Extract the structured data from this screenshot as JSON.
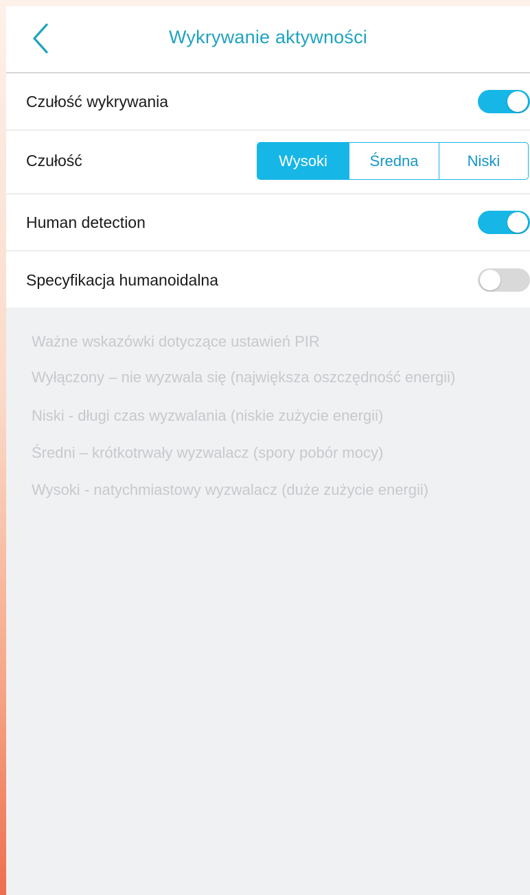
{
  "header": {
    "title": "Wykrywanie aktywności"
  },
  "settings": {
    "motion_sensitivity": {
      "label": "Czułość wykrywania",
      "enabled": true
    },
    "sensitivity": {
      "label": "Czułość",
      "options": [
        "Wysoki",
        "Średna",
        "Niski"
      ],
      "selected": "Wysoki"
    },
    "human_detection": {
      "label": "Human detection",
      "enabled": true
    },
    "humanoid_spec": {
      "label": "Specyfikacja humanoidalna",
      "enabled": false
    }
  },
  "notes": {
    "items": [
      "Ważne wskazówki dotyczące ustawień PIR",
      "Wyłączony – nie wyzwala się (największa oszczędność energii)",
      "Niski - długi czas wyzwalania (niskie zużycie energii)",
      "Średni – krótkotrwały wyzwalacz (spory pobór mocy)",
      "Wysoki - natychmiastowy wyzwalacz (duże zużycie energii)"
    ]
  },
  "colors": {
    "accent": "#16b6e6",
    "title": "#1fa3bf",
    "toggle_off": "#d9d9d9",
    "background": "#f0f1f3",
    "note_text": "#c8c9cc"
  },
  "icons": {
    "back": "chevron-left-icon"
  }
}
